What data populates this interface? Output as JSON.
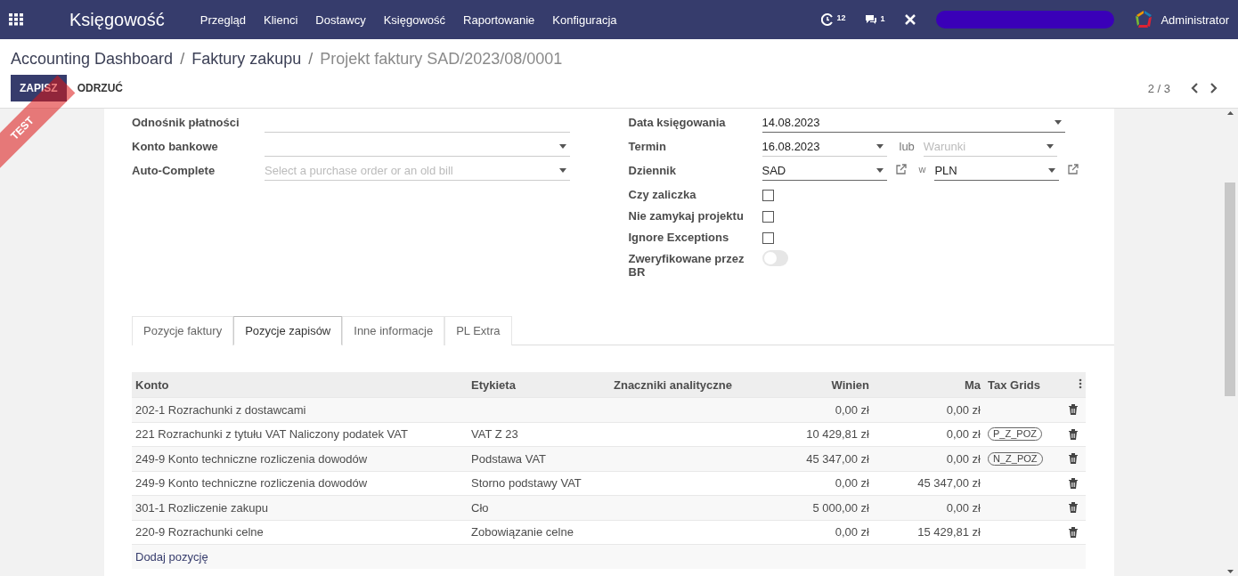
{
  "ribbon": {
    "label": "TEST"
  },
  "navbar": {
    "app_title": "Księgowość",
    "menu": [
      "Przegląd",
      "Klienci",
      "Dostawcy",
      "Księgowość",
      "Raportowanie",
      "Konfiguracja"
    ],
    "activity_count": "12",
    "message_count": "1",
    "user": "Administrator"
  },
  "breadcrumbs": [
    {
      "label": "Accounting Dashboard",
      "current": false
    },
    {
      "separator": "/",
      "label": "Faktury zakupu",
      "current": false
    },
    {
      "separator": "/",
      "label": "Projekt faktury SAD/2023/08/0001",
      "current": true
    }
  ],
  "actions": {
    "save": "ZAPISZ",
    "discard": "ODRZUĆ"
  },
  "pager": "2 / 3",
  "left_fields": [
    {
      "label": "Odnośnik płatności",
      "kind": "text"
    },
    {
      "label": "Konto bankowe",
      "kind": "select"
    },
    {
      "label": "Auto-Complete",
      "kind": "select",
      "placeholder": "Select a purchase order or an old bill"
    }
  ],
  "right_fields": [
    {
      "label": "Data księgowania",
      "kind": "select",
      "value": "14.08.2023"
    },
    {
      "label": "Termin",
      "kind": "date_terms",
      "value": "16.08.2023",
      "connector": "lub",
      "placeholder": "Warunki"
    },
    {
      "label": "Dziennik",
      "kind": "journal",
      "value": "SAD",
      "connector": "w",
      "currency": "PLN"
    },
    {
      "label": "Czy zaliczka",
      "kind": "checkbox",
      "checked": false
    },
    {
      "label": "Nie zamykaj projektu",
      "kind": "checkbox",
      "checked": false
    },
    {
      "label": "Ignore Exceptions",
      "kind": "checkbox",
      "checked": false
    },
    {
      "label": "Zweryfikowane przez BR",
      "kind": "toggle",
      "on": false
    }
  ],
  "tabs": [
    {
      "label": "Pozycje faktury",
      "selected": false
    },
    {
      "label": "Pozycje zapisów",
      "selected": true
    },
    {
      "label": "Inne informacje",
      "selected": false
    },
    {
      "label": "PL Extra",
      "selected": false
    }
  ],
  "table": {
    "columns": [
      "Konto",
      "Etykieta",
      "Znaczniki analityczne",
      "Winien",
      "Ma",
      "Tax Grids"
    ],
    "rows": [
      {
        "account": "202-1 Rozrachunki z dostawcami",
        "debit": "0,00 zł",
        "credit": "0,00 zł"
      },
      {
        "account": "221 Rozrachunki z tytułu VAT Naliczony podatek VAT",
        "label": "VAT Z 23",
        "debit": "10 429,81 zł",
        "credit": "0,00 zł",
        "tax_grid": "P_Z_POZ"
      },
      {
        "account": "249-9 Konto techniczne rozliczenia dowodów",
        "label": "Podstawa VAT",
        "debit": "45 347,00 zł",
        "credit": "0,00 zł",
        "tax_grid": "N_Z_POZ"
      },
      {
        "account": "249-9 Konto techniczne rozliczenia dowodów",
        "label": "Storno podstawy VAT",
        "debit": "0,00 zł",
        "credit": "45 347,00 zł"
      },
      {
        "account": "301-1 Rozliczenie zakupu",
        "label": "Cło",
        "debit": "5 000,00 zł",
        "credit": "0,00 zł"
      },
      {
        "account": "220-9 Rozrachunki celne",
        "label": "Zobowiązanie celne",
        "debit": "0,00 zł",
        "credit": "15 429,81 zł"
      }
    ],
    "add_line": "Dodaj pozycję"
  }
}
